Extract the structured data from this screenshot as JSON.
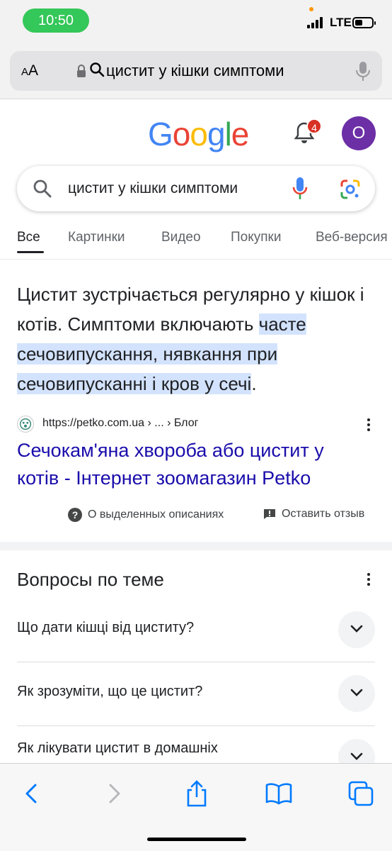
{
  "status_bar": {
    "time": "10:50",
    "network": "LTE",
    "battery_level": 0.45
  },
  "browser": {
    "text_size_label_small": "A",
    "text_size_label_large": "A",
    "address": "цистит у кішки симптоми"
  },
  "google": {
    "logo": [
      "G",
      "o",
      "o",
      "g",
      "l",
      "e"
    ],
    "logo_colors": [
      "#4285F4",
      "#EA4335",
      "#FBBC05",
      "#4285F4",
      "#34A853",
      "#EA4335"
    ],
    "notification_count": "4",
    "avatar_letter": "O",
    "search_query": "цистит у кішки симптоми"
  },
  "tabs": [
    "Все",
    "Картинки",
    "Видео",
    "Покупки",
    "Веб-версия"
  ],
  "snippet": {
    "text_plain": "Цистит зустрічається регулярно у кішок і котів. Симптоми включають ",
    "text_highlight": "часте сечовипускання, нявкання при сечовипусканні і кров у сечі",
    "text_end": ".",
    "source_url": "https://petko.com.ua › ... › Блог",
    "title": "Сечокам'яна хвороба або цистит у котів - Інтернет зоомагазин Petko",
    "about_label": "О выделенных описаниях",
    "feedback_label": "Оставить отзыв"
  },
  "paa": {
    "title": "Вопросы по теме",
    "questions": [
      "Що дати кішці від циститу?",
      "Як зрозуміти, що це цистит?",
      "Як лікувати цистит в домашніх"
    ]
  },
  "colors": {
    "link": "#1a0dab",
    "highlight": "#d3e3fd",
    "ios_blue": "#007aff",
    "time_pill": "#34c759",
    "avatar": "#6c2fa6",
    "badge": "#d93025"
  }
}
